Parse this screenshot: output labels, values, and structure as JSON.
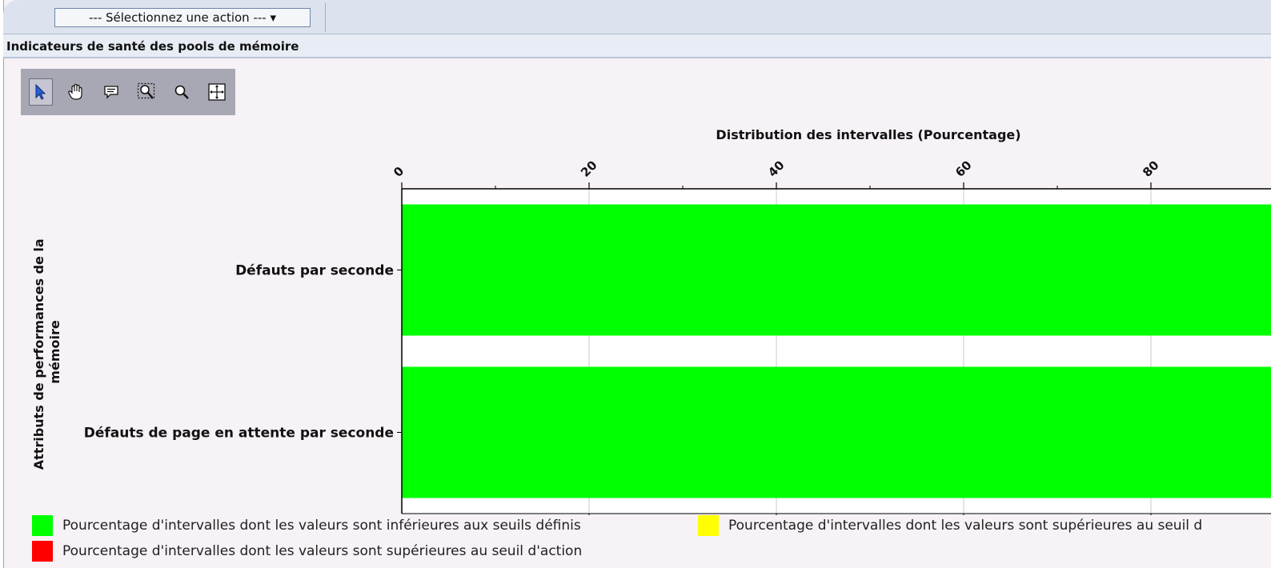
{
  "header": {
    "action_select": "--- Sélectionnez une action --- ▾"
  },
  "panel": {
    "title": "Indicateurs de santé des pools de mémoire"
  },
  "toolbar": {
    "tools": [
      {
        "icon": "select-arrow-icon",
        "active": true
      },
      {
        "icon": "pan-hand-icon",
        "active": false
      },
      {
        "icon": "tooltip-balloon-icon",
        "active": false
      },
      {
        "icon": "zoom-box-icon",
        "active": false
      },
      {
        "icon": "zoom-out-icon",
        "active": false
      },
      {
        "icon": "fit-to-window-icon",
        "active": false
      }
    ]
  },
  "colors": {
    "green": "#00ff00",
    "yellow": "#ffff00",
    "red": "#ff0000"
  },
  "chart_data": {
    "type": "bar",
    "orientation": "horizontal",
    "title": "Distribution des intervalles  (Pourcentage)",
    "ylabel_lines": [
      "Attributs de performances de la",
      "mémoire"
    ],
    "categories": [
      "Défauts par seconde",
      "Défauts de page en attente par seconde"
    ],
    "series": [
      {
        "name": "Pourcentage d'intervalles dont les valeurs sont inférieures aux seuils définis",
        "color": "#00ff00",
        "values": [
          100,
          100
        ]
      }
    ],
    "xlim": [
      0,
      100
    ],
    "x_ticks": [
      "0",
      "20",
      "40",
      "60",
      "80"
    ],
    "grid": true,
    "stacked": true
  },
  "legend": [
    {
      "label": "Pourcentage d'intervalles dont les valeurs sont inférieures aux seuils définis",
      "color": "#00ff00"
    },
    {
      "label": "Pourcentage d'intervalles dont les valeurs sont supérieures au seuil d",
      "color": "#ffff00"
    },
    {
      "label": "Pourcentage d'intervalles dont les valeurs sont supérieures au seuil d'action",
      "color": "#ff0000"
    }
  ]
}
